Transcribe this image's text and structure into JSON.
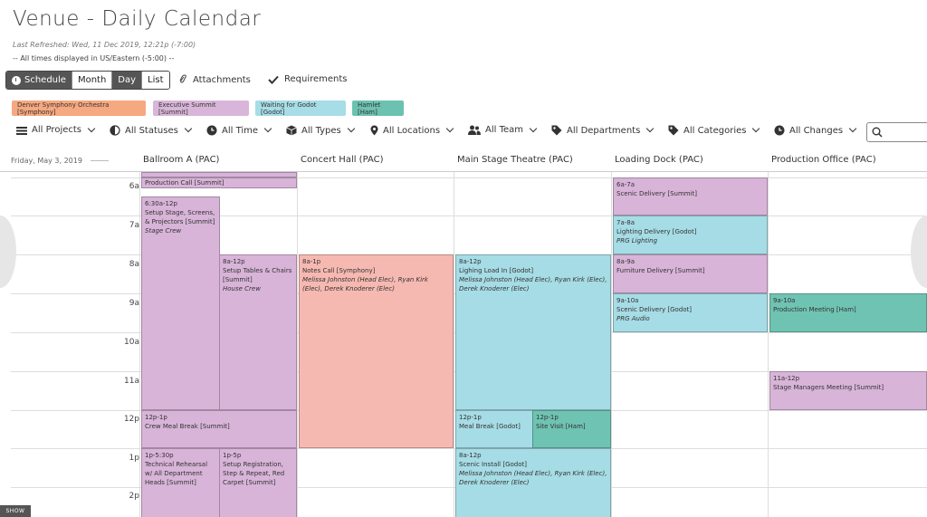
{
  "page": {
    "title": "Venue - Daily Calendar",
    "refreshed": "Last Refreshed: Wed, 11 Dec 2019, 12:21p (-7:00)",
    "timezone": "-- All times displayed in US/Eastern (-5:00) --"
  },
  "viewbar": {
    "schedule": "Schedule",
    "month": "Month",
    "day": "Day",
    "list": "List"
  },
  "toolbar": {
    "attachments": "Attachments",
    "requirements": "Requirements"
  },
  "legend": [
    {
      "label": "Denver Symphony Orchestra [Symphony]",
      "color": "#f6a880"
    },
    {
      "label": "Executive Summit [Summit]",
      "color": "#d9b6d9"
    },
    {
      "label": "Waiting for Godot [Godot]",
      "color": "#a7dde7"
    },
    {
      "label": "Hamlet [Ham]",
      "color": "#6cc2b0"
    }
  ],
  "filters": {
    "projects": "All Projects",
    "statuses": "All Statuses",
    "time": "All Time",
    "types": "All Types",
    "locations": "All Locations",
    "team": "All Team",
    "departments": "All Departments",
    "categories": "All Categories",
    "changes": "All Changes"
  },
  "calendar": {
    "date": "Friday, May 3, 2019",
    "columns": [
      "Ballroom A (PAC)",
      "Concert Hall (PAC)",
      "Main Stage Theatre (PAC)",
      "Loading Dock (PAC)",
      "Production Office (PAC)"
    ],
    "hours": [
      "6a",
      "7a",
      "8a",
      "9a",
      "10a",
      "11a",
      "12p",
      "1p",
      "2p"
    ]
  },
  "events": {
    "prodcall": {
      "title": "Production Call [Summit]"
    },
    "setupstage": {
      "time": "6:30a-12p",
      "title": "Setup Stage, Screens, & Projectors [Summit]",
      "crew": "Stage Crew"
    },
    "setuptables": {
      "time": "8a-12p",
      "title": "Setup Tables & Chairs [Summit]",
      "crew": "House Crew"
    },
    "crewmeal": {
      "time": "12p-1p",
      "title": "Crew Meal Break [Summit]"
    },
    "techreh": {
      "time": "1p-5:30p",
      "title": "Technical Rehearsal w/ All Department Heads [Summit]"
    },
    "setupreg": {
      "time": "1p-5p",
      "title": "Setup Registration, Step & Repeat, Red Carpet [Summit]"
    },
    "notescall": {
      "time": "8a-1p",
      "title": "Notes Call [Symphony]",
      "crew": "Melissa Johnston (Head Elec), Ryan Kirk (Elec), Derek Knoderer (Elec)"
    },
    "lighting": {
      "time": "8a-12p",
      "title": "Lighing Load In [Godot]",
      "crew": "Melissa Johnston (Head Elec), Ryan Kirk (Elec), Derek Knoderer (Elec)"
    },
    "mealbreak": {
      "time": "12p-1p",
      "title": "Meal Break [Godot]"
    },
    "sitevisit": {
      "time": "12p-1p",
      "title": "Site Visit [Ham]"
    },
    "scenicinstall": {
      "time": "8a-12p",
      "title": "Scenic Install [Godot]",
      "crew": "Melissa Johnston (Head Elec), Ryan Kirk (Elec), Derek Knoderer (Elec)"
    },
    "scenic1": {
      "time": "6a-7a",
      "title": "Scenic Delivery [Summit]"
    },
    "lightdel": {
      "time": "7a-8a",
      "title": "Lighting Delivery [Godot]",
      "crew": "PRG Lighting"
    },
    "furniture": {
      "time": "8a-9a",
      "title": "Furniture Delivery [Summit]"
    },
    "scenic2": {
      "time": "9a-10a",
      "title": "Scenic Delivery [Godot]",
      "crew": "PRG Audio"
    },
    "prodmeeting": {
      "time": "9a-10a",
      "title": "Production Meeting [Ham]"
    },
    "smmeeting": {
      "time": "11a-12p",
      "title": "Stage Managers Meeting [Summit]"
    }
  },
  "footer": {
    "show": "SHOW"
  }
}
